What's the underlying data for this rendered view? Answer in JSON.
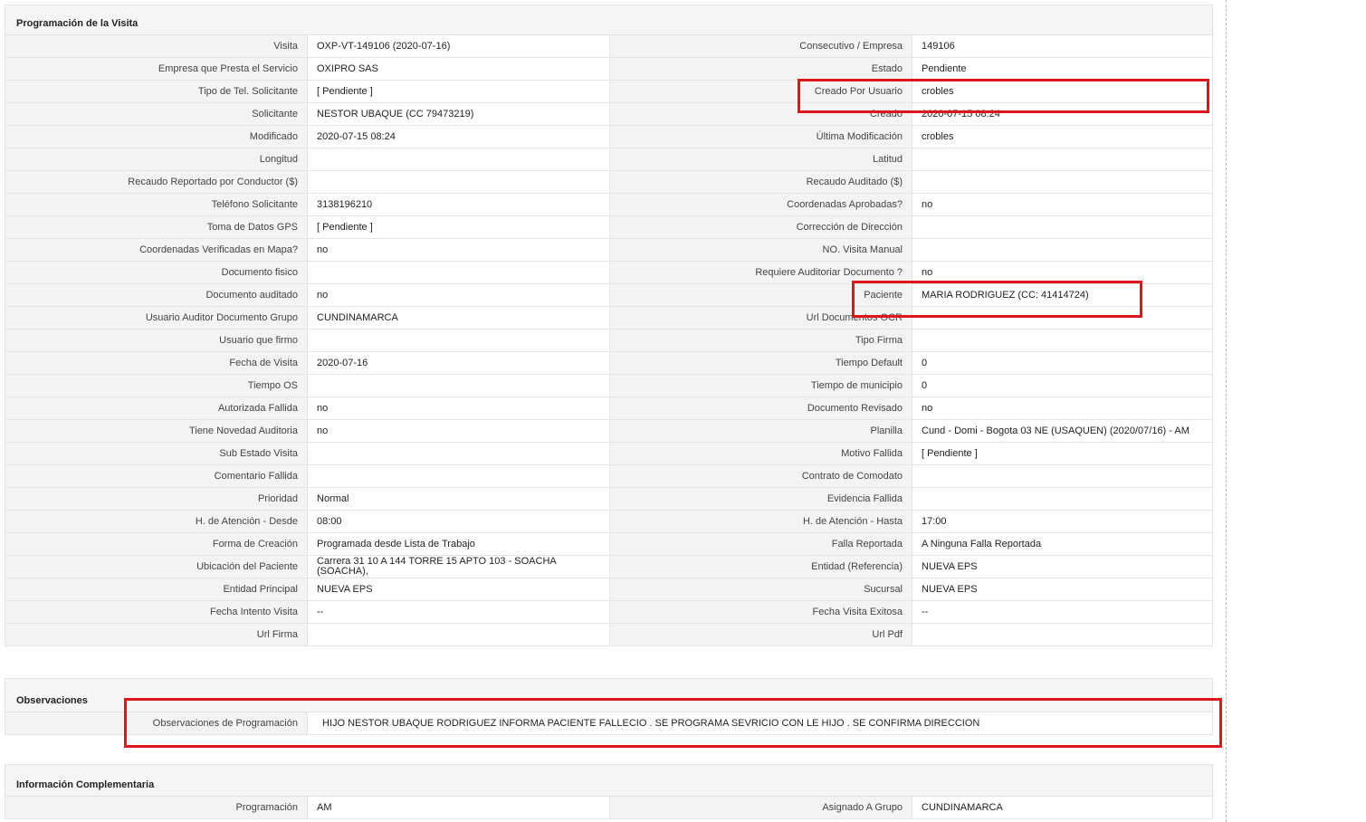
{
  "programacion": {
    "title": "Programación de la Visita",
    "rows": [
      {
        "l1": "Visita",
        "v1": "OXP-VT-149106 (2020-07-16)",
        "l2": "Consecutivo / Empresa",
        "v2": "149106"
      },
      {
        "l1": "Empresa que Presta el Servicio",
        "v1": "OXIPRO SAS",
        "l2": "Estado",
        "v2": "Pendiente"
      },
      {
        "l1": "Tipo de Tel. Solicitante",
        "v1": "[ Pendiente ]",
        "l2": "Creado Por Usuario",
        "v2": "crobles"
      },
      {
        "l1": "Solicitante",
        "v1": "NESTOR UBAQUE (CC 79473219)",
        "l2": "Creado",
        "v2": "2020-07-15 08:24"
      },
      {
        "l1": "Modificado",
        "v1": "2020-07-15 08:24",
        "l2": "Última Modificación",
        "v2": " crobles"
      },
      {
        "l1": "Longitud",
        "v1": "",
        "l2": "Latitud",
        "v2": ""
      },
      {
        "l1": "Recaudo Reportado por Conductor ($)",
        "v1": "",
        "l2": "Recaudo Auditado ($)",
        "v2": ""
      },
      {
        "l1": "Teléfono Solicitante",
        "v1": "3138196210",
        "l2": "Coordenadas Aprobadas?",
        "v2": " no"
      },
      {
        "l1": "Toma de Datos GPS",
        "v1": "[ Pendiente ]",
        "l2": "Corrección de Dirección",
        "v2": ""
      },
      {
        "l1": "Coordenadas Verificadas en Mapa?",
        "v1": " no",
        "l2": "NO. Visita Manual",
        "v2": ""
      },
      {
        "l1": "Documento fisico",
        "v1": "",
        "l2": "Requiere Auditoriar Documento ?",
        "v2": " no"
      },
      {
        "l1": "Documento auditado",
        "v1": " no",
        "l2": "Paciente",
        "v2": "MARIA RODRIGUEZ (CC: 41414724)"
      },
      {
        "l1": "Usuario Auditor Documento Grupo",
        "v1": "CUNDINAMARCA",
        "l2": "Url Documentos OCR",
        "v2": ""
      },
      {
        "l1": "Usuario que firmo",
        "v1": "",
        "l2": "Tipo Firma",
        "v2": ""
      },
      {
        "l1": "Fecha de Visita",
        "v1": " 2020-07-16",
        "l2": "Tiempo Default",
        "v2": "0"
      },
      {
        "l1": "Tiempo OS",
        "v1": "",
        "l2": "Tiempo de municipio",
        "v2": "0"
      },
      {
        "l1": "Autorizada Fallida",
        "v1": " no",
        "l2": "Documento Revisado",
        "v2": " no"
      },
      {
        "l1": "Tiene Novedad Auditoria",
        "v1": " no",
        "l2": "Planilla",
        "v2": "Cund - Domi - Bogota 03 NE (USAQUEN) (2020/07/16) - AM"
      },
      {
        "l1": "Sub Estado Visita",
        "v1": "",
        "l2": "Motivo Fallida",
        "v2": "[ Pendiente ]"
      },
      {
        "l1": "Comentario Fallida",
        "v1": "",
        "l2": "Contrato de Comodato",
        "v2": ""
      },
      {
        "l1": "Prioridad",
        "v1": "Normal",
        "l2": "Evidencia Fallida",
        "v2": ""
      },
      {
        "l1": "H. de Atención - Desde",
        "v1": "08:00",
        "l2": "H. de Atención - Hasta",
        "v2": "17:00"
      },
      {
        "l1": "Forma de Creación",
        "v1": "Programada desde Lista de Trabajo",
        "l2": "Falla Reportada",
        "v2": "A Ninguna Falla Reportada"
      },
      {
        "l1": "Ubicación del Paciente",
        "v1": "Carrera 31 10 A 144 TORRE 15 APTO 103 - SOACHA (SOACHA),",
        "l2": "Entidad (Referencia)",
        "v2": "NUEVA EPS"
      },
      {
        "l1": "Entidad Principal",
        "v1": "NUEVA EPS",
        "l2": "Sucursal",
        "v2": "NUEVA EPS"
      },
      {
        "l1": "Fecha Intento Visita",
        "v1": " --",
        "l2": "Fecha Visita Exitosa",
        "v2": " --"
      },
      {
        "l1": "Url Firma",
        "v1": "",
        "l2": "Url Pdf",
        "v2": ""
      }
    ]
  },
  "observaciones": {
    "title": "Observaciones",
    "label": "Observaciones de Programación",
    "value": "HIJO NESTOR UBAQUE RODRIGUEZ INFORMA PACIENTE FALLECIO . SE PROGRAMA SEVRICIO CON LE HIJO . SE CONFIRMA DIRECCION"
  },
  "complementaria": {
    "title": "Información Complementaria",
    "rows": [
      {
        "l1": "Programación",
        "v1": "AM",
        "l2": "Asignado A Grupo",
        "v2": "CUNDINAMARCA"
      }
    ]
  },
  "colors": {
    "highlight": "#e0141e",
    "label_bg": "#f3f3f3",
    "header_bg": "#f5f5f5"
  }
}
